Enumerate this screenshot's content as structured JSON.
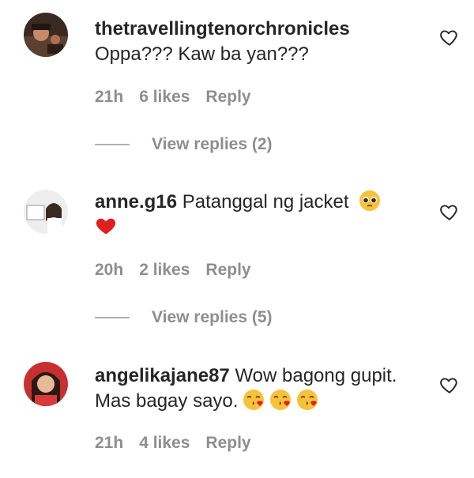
{
  "comments": [
    {
      "username": "thetravellingtenorchronicles",
      "text": "Oppa??? Kaw ba yan???",
      "time": "21h",
      "likes": "6 likes",
      "reply_label": "Reply",
      "view_replies": "View replies (2)",
      "avatar_icon": "profile-photo"
    },
    {
      "username": "anne.g16",
      "text": "Patanggal ng jacket",
      "emojis": [
        "pleading-face-emoji",
        "red-heart-emoji"
      ],
      "time": "20h",
      "likes": "2 likes",
      "reply_label": "Reply",
      "view_replies": "View replies (5)",
      "avatar_icon": "profile-photo"
    },
    {
      "username": "angelikajane87",
      "text": "Wow bagong gupit. Mas bagay sayo.",
      "emojis": [
        "face-blowing-kiss-emoji",
        "face-blowing-kiss-emoji",
        "face-blowing-kiss-emoji"
      ],
      "time": "21h",
      "likes": "4 likes",
      "reply_label": "Reply",
      "avatar_icon": "profile-photo"
    }
  ],
  "colors": {
    "text": "#262626",
    "secondary": "#8e8e8e",
    "heart_emoji": "#e02020",
    "emoji_face": "#f7c23a"
  }
}
